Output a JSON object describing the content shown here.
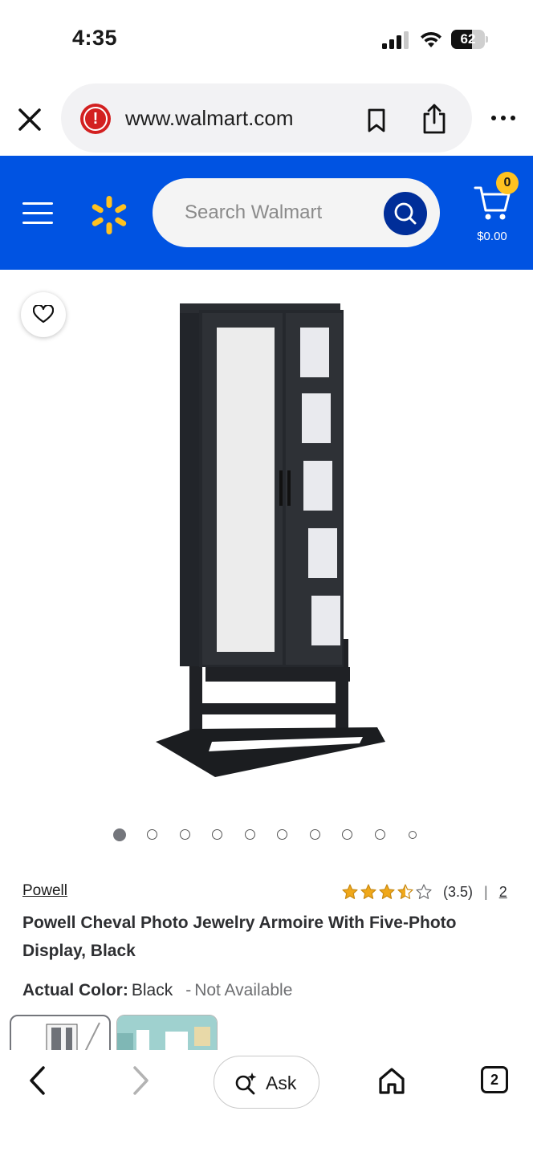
{
  "status_bar": {
    "time": "4:35",
    "battery_percent": "62",
    "battery_level": 0.62
  },
  "browser": {
    "url": "www.walmart.com",
    "icons": [
      "close-icon",
      "warning-icon",
      "bookmark-icon",
      "share-icon",
      "more-icon"
    ],
    "accent_color": "#d32020"
  },
  "header": {
    "search_placeholder": "Search Walmart",
    "cart_count": "0",
    "cart_total": "$0.00",
    "brand_color": "#0053e2",
    "spark_color": "#ffc220",
    "icons": [
      "menu-icon",
      "spark-logo",
      "search-icon",
      "cart-icon"
    ]
  },
  "product": {
    "brand": "Powell",
    "rating_value": 3.5,
    "rating_text": "(3.5)",
    "rating_separator": "|",
    "review_count": "2",
    "title": "Powell Cheval Photo Jewelry Armoire With Five-Photo Display, Black",
    "color_label": "Actual Color:",
    "color_value": "Black",
    "color_separator": "-",
    "availability": "Not Available",
    "image_count": 10,
    "active_image_index": 0
  },
  "bottom_bar": {
    "ask_label": "Ask",
    "tab_count": "2",
    "icons": [
      "back-icon",
      "forward-icon",
      "ask-sparkle-icon",
      "home-icon",
      "tabs-icon"
    ]
  }
}
